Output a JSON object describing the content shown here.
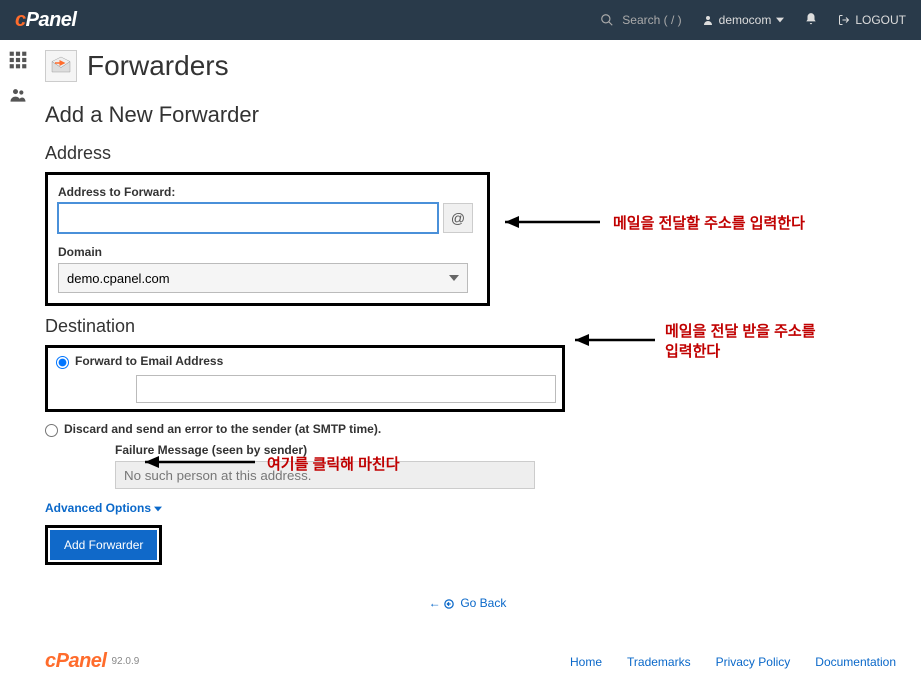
{
  "header": {
    "brand": "cPanel",
    "search_placeholder": "Search ( / )",
    "user_label": "democom",
    "logout_label": "LOGOUT"
  },
  "page": {
    "title": "Forwarders",
    "section_title": "Add a New Forwarder",
    "address_heading": "Address",
    "address_label": "Address to Forward:",
    "address_value": "",
    "at_symbol": "@",
    "domain_label": "Domain",
    "domain_value": "demo.cpanel.com",
    "destination_heading": "Destination",
    "forward_radio_label": "Forward to Email Address",
    "forward_value": "",
    "discard_radio_label": "Discard and send an error to the sender (at SMTP time).",
    "failure_label": "Failure Message (seen by sender)",
    "failure_value": "No such person at this address.",
    "advanced_link": "Advanced Options",
    "submit_button": "Add Forwarder",
    "goback_link": "Go Back"
  },
  "annotations": {
    "callout1": "메일을 전달할 주소를 입력한다",
    "callout2_line1": "메일을 전달 받을 주소를",
    "callout2_line2": "입력한다",
    "callout3": "여기를 클릭해 마친다"
  },
  "footer": {
    "brand": "cPanel",
    "version": "92.0.9",
    "links": [
      "Home",
      "Trademarks",
      "Privacy Policy",
      "Documentation"
    ]
  }
}
